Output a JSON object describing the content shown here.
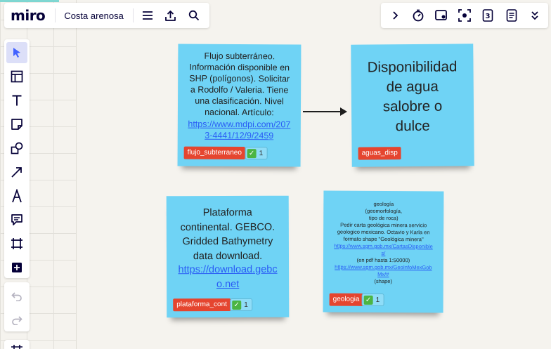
{
  "app": {
    "logo": "miro",
    "board_name": "Costa arenosa"
  },
  "top_left_icons": [
    "menu-icon",
    "share-upload-icon",
    "search-icon"
  ],
  "top_right_icons": [
    "chevron-right-icon",
    "timer-icon",
    "presentation-icon",
    "focus-icon",
    "page-count-icon",
    "notes-icon",
    "chevron-double-down-icon"
  ],
  "page_count": "3",
  "left_tools": [
    "select",
    "templates",
    "text",
    "sticky-note",
    "shapes",
    "connection-line",
    "pen",
    "comment",
    "frame",
    "add-more"
  ],
  "stickies": [
    {
      "text": "Flujo subterráneo.\nInformación disponible en\nSHP (polígonos). Solicitar\na Rodolfo / Valeria. Tiene\nuna clasificación. Nivel\nnacional. Artículo:",
      "link": "https://www.mdpi.com/2073-4441/12/9/2459",
      "tag": "flujo_subterraneo",
      "reaction_count": "1"
    },
    {
      "text": "Disponibilidad\nde agua\nsalobre o\ndulce",
      "tag": "aguas_disp"
    },
    {
      "text": "Plataforma\ncontinental. GEBCO.\nGridded Bathymetry\ndata download.",
      "link": "https://download.gebco.net",
      "tag": "plataforma_cont",
      "reaction_count": "1"
    },
    {
      "text_top": "geología\n(geomorfología,\ntipo de roca)\nPedir carta geológica minera servicio\ngeologico mexicano. Octavio  y Karla en\nformato shape \"Geológica minera\"",
      "link1": "https://www.sgm.gob.mx/CartasDisponibles/",
      "mid": "(en pdf hasta 1:50000)",
      "link2": "https://www.sgm.gob.mx/GeoInfoMexGobMx/#",
      "text_bottom": "(shape)",
      "tag": "geologia",
      "reaction_count": "1"
    }
  ],
  "colors": {
    "sticky": "#6fd3f5",
    "tag": "#e5452f",
    "link": "#2a5df5",
    "active_tool": "#dcdff8"
  }
}
